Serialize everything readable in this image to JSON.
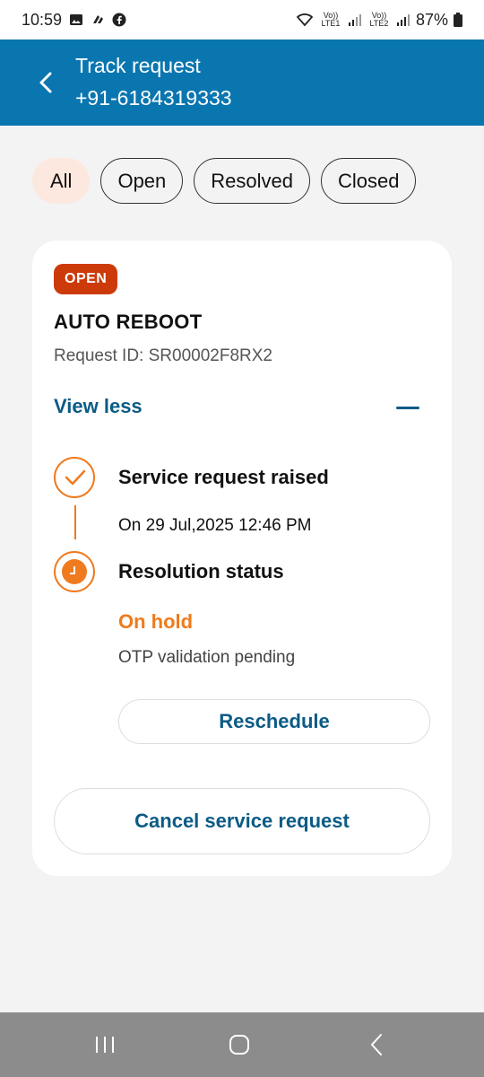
{
  "status_bar": {
    "time": "10:59",
    "battery": "87%",
    "left_icons": [
      "gallery-icon",
      "cloud-icon",
      "facebook-icon"
    ],
    "right_icons": [
      "wifi-icon",
      "signal-icon"
    ],
    "sim1_label": "Vo)) LTE1",
    "sim2_label": "Vo)) LTE2"
  },
  "header": {
    "title": "Track request",
    "subtitle": "+91-6184319333",
    "color": "#0a76b0"
  },
  "filters": {
    "items": [
      {
        "label": "All",
        "active": true
      },
      {
        "label": "Open",
        "active": false
      },
      {
        "label": "Resolved",
        "active": false
      },
      {
        "label": "Closed",
        "active": false
      }
    ]
  },
  "request": {
    "badge": "OPEN",
    "badge_color": "#cc3a0a",
    "title": "AUTO REBOOT",
    "request_id": "Request ID: SR00002F8RX2",
    "toggle_label": "View less",
    "timeline": [
      {
        "title": "Service request raised",
        "detail": "On 29 Jul,2025 12:46 PM",
        "icon": "check-icon"
      },
      {
        "title": "Resolution status",
        "status": "On hold",
        "detail": "OTP validation pending",
        "icon": "clock-icon"
      }
    ],
    "accent_color": "#f07a1e",
    "reschedule_label": "Reschedule",
    "cancel_label": "Cancel service request"
  },
  "nav_bar": {
    "icons": [
      "recent-apps-icon",
      "home-icon",
      "back-icon"
    ]
  }
}
